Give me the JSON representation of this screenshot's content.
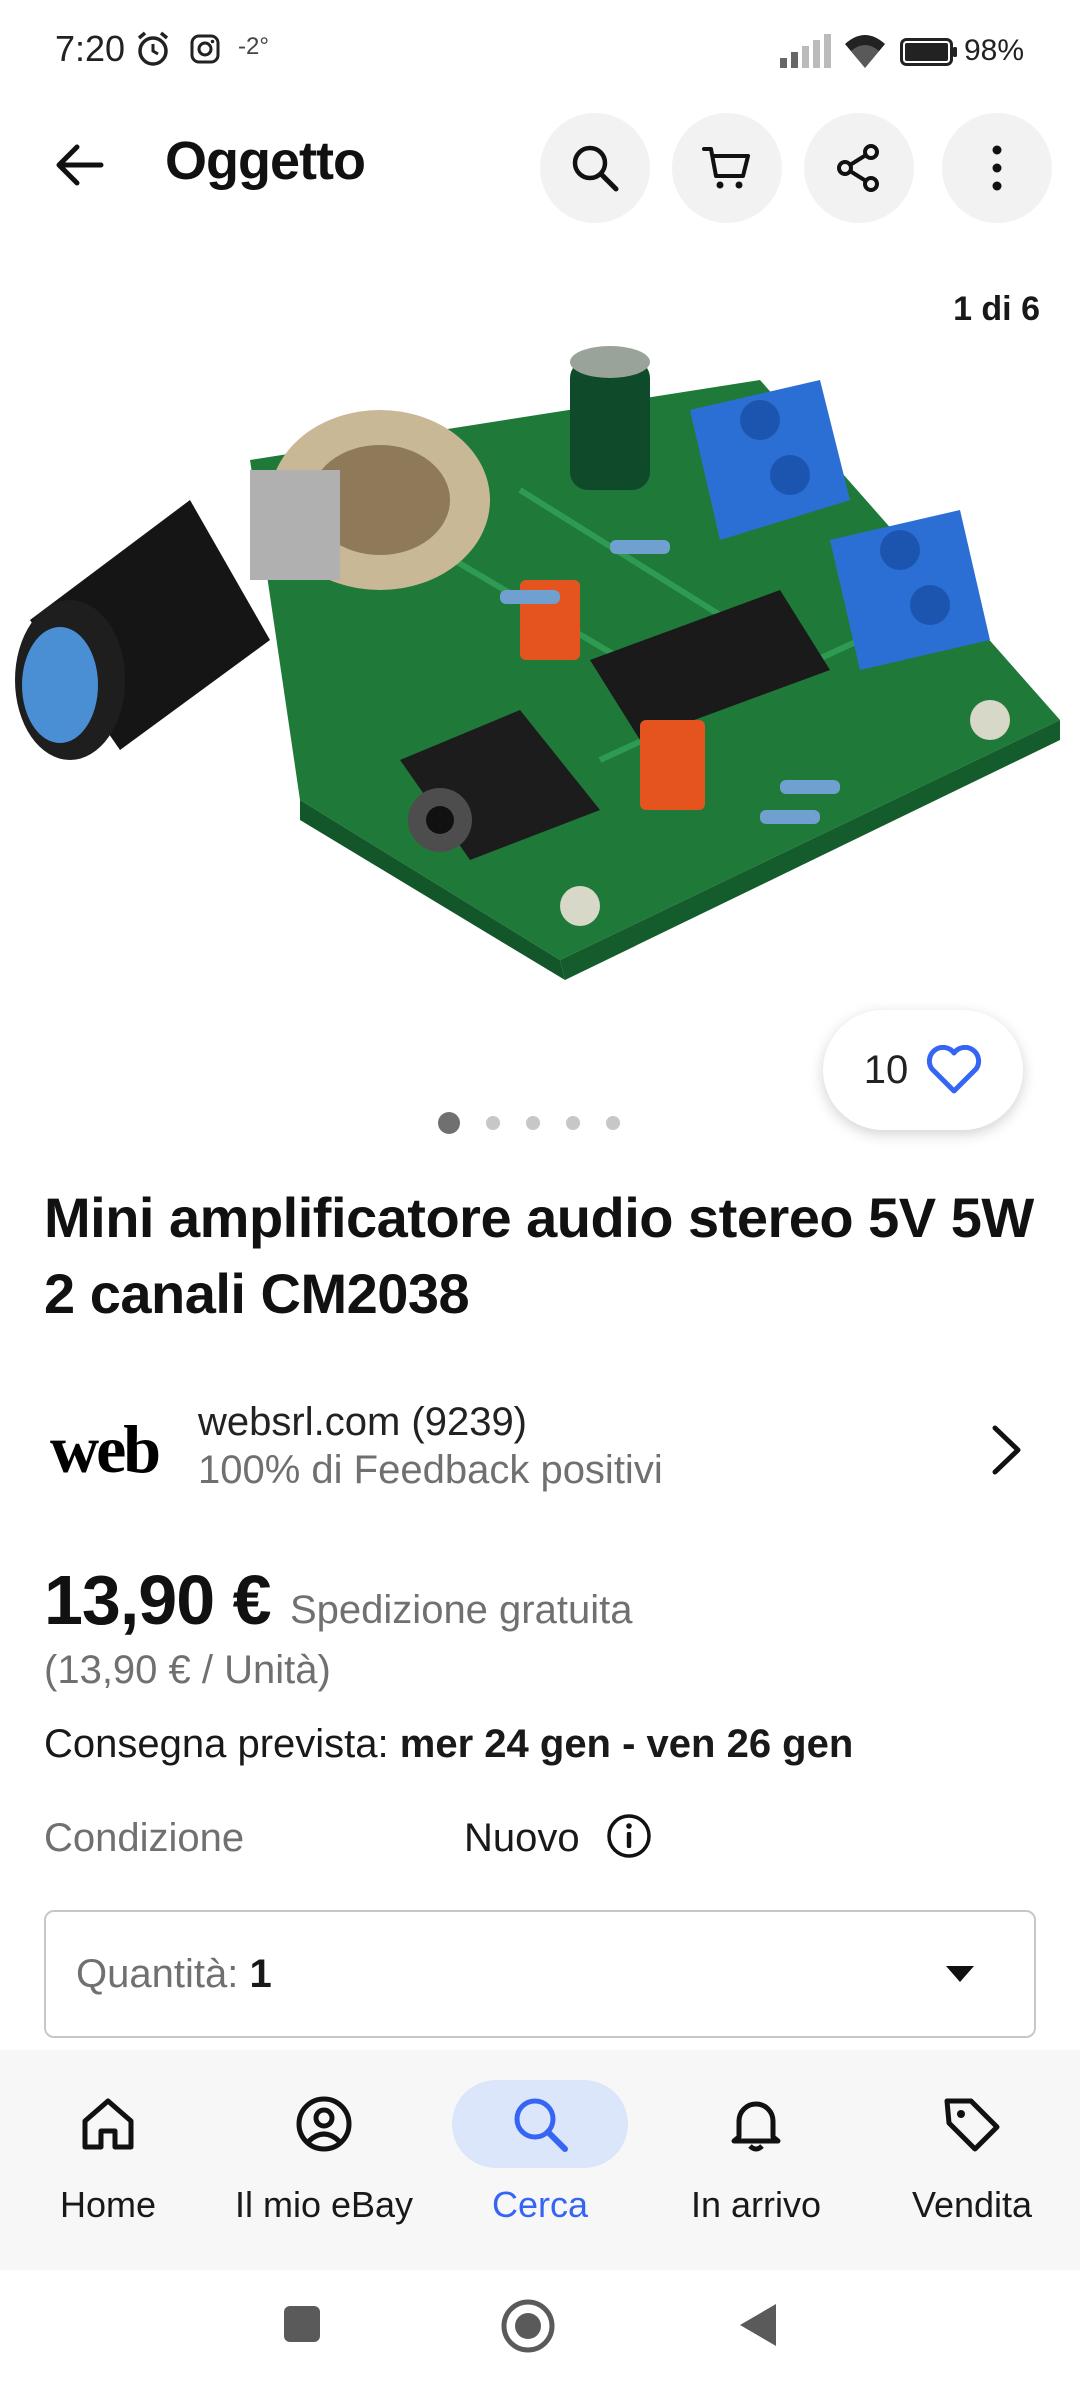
{
  "status_bar": {
    "time": "7:20",
    "temperature": "-2°",
    "battery": "98%"
  },
  "app_bar": {
    "title": "Oggetto",
    "icons": [
      "back-arrow-icon",
      "search-icon",
      "cart-icon",
      "share-icon",
      "more-vertical-icon"
    ]
  },
  "gallery": {
    "counter": "1 di 6",
    "watch_count": "10",
    "dots_total": 5,
    "dots_active_index": 0
  },
  "item": {
    "title": "Mini amplificatore audio stereo 5V 5W 2 canali CM2038"
  },
  "seller": {
    "logo_text": "web",
    "name": "websrl.com (9239)",
    "feedback": "100% di Feedback positivi"
  },
  "pricing": {
    "price": "13,90 €",
    "shipping": "Spedizione gratuita",
    "unit_price": "(13,90 € / Unità)",
    "delivery_label": "Consegna prevista:",
    "delivery_dates": "mer 24 gen - ven 26 gen"
  },
  "condition": {
    "label": "Condizione",
    "value": "Nuovo"
  },
  "quantity": {
    "label": "Quantità:",
    "value": "1"
  },
  "bottom_nav": {
    "items": [
      {
        "label": "Home",
        "icon": "home-icon"
      },
      {
        "label": "Il mio eBay",
        "icon": "profile-icon"
      },
      {
        "label": "Cerca",
        "icon": "search-icon",
        "active": true
      },
      {
        "label": "In arrivo",
        "icon": "bell-icon"
      },
      {
        "label": "Vendita",
        "icon": "tag-icon"
      }
    ]
  },
  "colors": {
    "accent": "#3665f3",
    "active_nav_bg": "#dbe6fb",
    "secondary_text": "#707070"
  }
}
